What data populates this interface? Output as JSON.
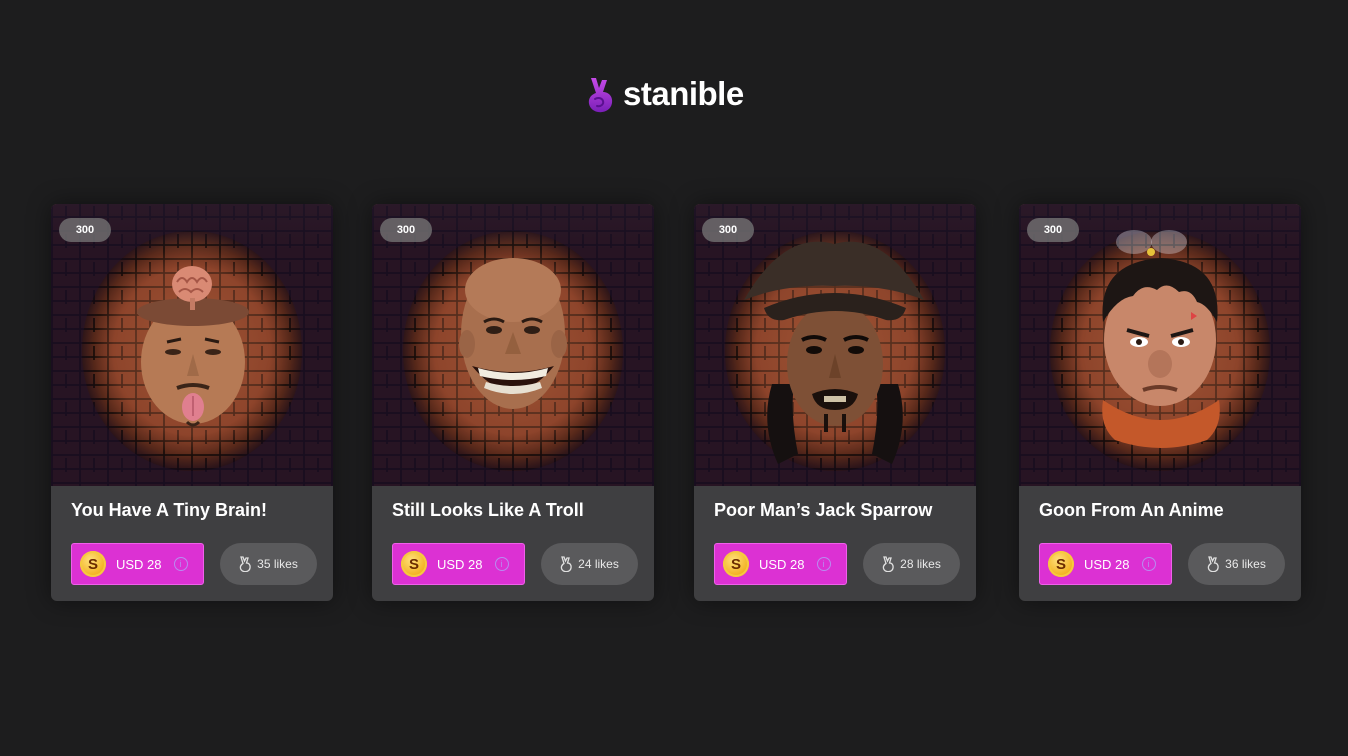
{
  "brand": {
    "name": "stanible",
    "accent": "#9b2fd6"
  },
  "cards": [
    {
      "edition": "300",
      "title": "You Have A Tiny Brain!",
      "price_label": "USD 28",
      "coin_letter": "S",
      "likes_label": "35 likes"
    },
    {
      "edition": "300",
      "title": "Still Looks Like A Troll",
      "price_label": "USD 28",
      "coin_letter": "S",
      "likes_label": "24 likes"
    },
    {
      "edition": "300",
      "title": "Poor Man’s Jack Sparrow",
      "price_label": "USD 28",
      "coin_letter": "S",
      "likes_label": "28 likes"
    },
    {
      "edition": "300",
      "title": "Goon From An Anime",
      "price_label": "USD 28",
      "coin_letter": "S",
      "likes_label": "36 likes"
    }
  ],
  "colors": {
    "background": "#1d1d1e",
    "card": "#3f3f41",
    "price_button": "#dc31d3",
    "likes_button": "#5a5a5c"
  },
  "icons": {
    "brand": "crossed-fingers-icon",
    "coin": "stanible-coin-icon",
    "info": "info-icon",
    "likes": "crossed-fingers-icon"
  }
}
